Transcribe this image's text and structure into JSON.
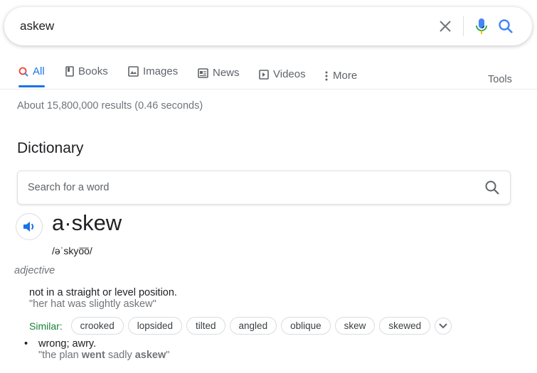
{
  "search": {
    "query": "askew"
  },
  "tabs": [
    {
      "label": "All",
      "icon": "search-icon"
    },
    {
      "label": "Books",
      "icon": "book-icon"
    },
    {
      "label": "Images",
      "icon": "image-icon"
    },
    {
      "label": "News",
      "icon": "news-icon"
    },
    {
      "label": "Videos",
      "icon": "video-icon"
    },
    {
      "label": "More",
      "icon": "more-vert-icon"
    }
  ],
  "tools_label": "Tools",
  "stats": "About 15,800,000 results (0.46 seconds)",
  "dictionary": {
    "title": "Dictionary",
    "search_placeholder": "Search for a word",
    "word": "a·skew",
    "phonetic": "/əˈskyo͞o/",
    "part_of_speech": "adjective",
    "definitions": [
      {
        "text": "not in a straight or level position.",
        "example": "\"her hat was slightly askew\""
      },
      {
        "text": "wrong; awry.",
        "example_pre": "\"the plan ",
        "example_b1": "went",
        "example_mid": " sadly ",
        "example_b2": "askew",
        "example_post": "\""
      }
    ],
    "similar_label": "Similar:",
    "similar": [
      "crooked",
      "lopsided",
      "tilted",
      "angled",
      "oblique",
      "skew",
      "skewed"
    ]
  },
  "colors": {
    "accent": "#1a73e8",
    "similar": "#188038"
  }
}
